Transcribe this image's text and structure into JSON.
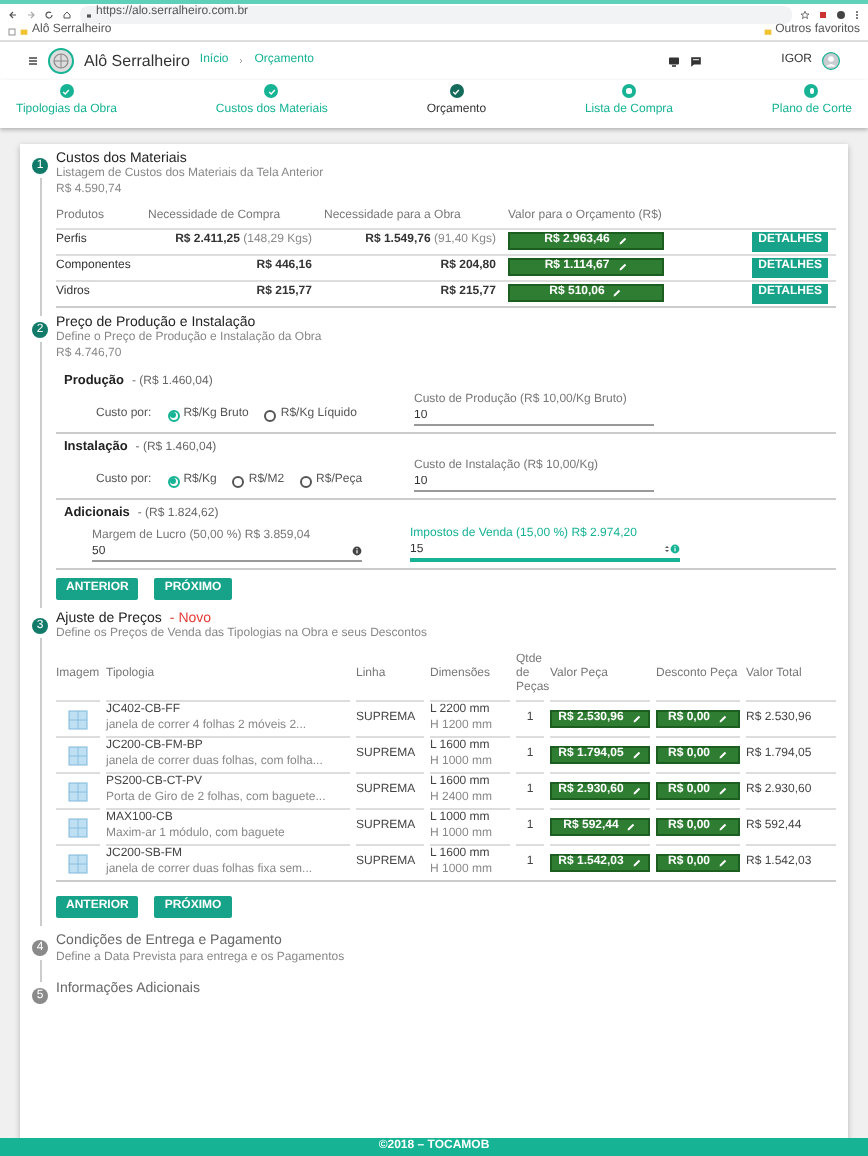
{
  "browser": {
    "url": "https://alo.serralheiro.com.br",
    "bookmark": "Alô Serralheiro",
    "other_bookmarks": "Outros favoritos"
  },
  "header": {
    "app_name": "Alô Serralheiro",
    "breadcrumb": [
      "Início",
      "Orçamento"
    ],
    "user": "IGOR"
  },
  "stepper": [
    {
      "label": "Tipologias da Obra",
      "done": true,
      "selected": false
    },
    {
      "label": "Custos dos Materiais",
      "done": true,
      "selected": false
    },
    {
      "label": "Orçamento",
      "done": true,
      "selected": true
    },
    {
      "label": "Lista de Compra",
      "done": false,
      "selected": false
    },
    {
      "label": "Plano de Corte",
      "done": false,
      "selected": false
    }
  ],
  "materials": {
    "number": "1",
    "active": true,
    "title": "Custos dos Materiais",
    "subtitle": "Listagem de Custos dos Materiais da Tela Anterior",
    "total": "R$ 4.590,74",
    "columns": [
      "Produtos",
      "Necessidade de Compra",
      "Necessidade para a Obra",
      "Valor para o Orçamento (R$)"
    ],
    "rows": [
      {
        "product": "Perfis",
        "purchase": "R$ 2.411,25",
        "purchase_weight": "(148,29 Kgs)",
        "work": "R$ 1.549,76",
        "work_weight": "(91,40 Kgs)",
        "value": "R$ 2.963,46",
        "action": "DETALHES"
      },
      {
        "product": "Componentes",
        "purchase": "R$ 446,16",
        "work": "R$ 204,80",
        "value": "R$ 1.114,67",
        "action": "DETALHES"
      },
      {
        "product": "Vidros",
        "purchase": "R$ 215,77",
        "work": "R$ 215,77",
        "value": "R$ 510,06",
        "action": "DETALHES"
      }
    ]
  },
  "production": {
    "number": "2",
    "active": true,
    "title": "Preço de Produção e Instalação",
    "subtitle": "Define o Preço de Produção e Instalação da Obra",
    "total": "R$ 4.746,70",
    "groups": [
      {
        "kind": "radio",
        "title": "Produção",
        "amount": "- (R$ 1.460,04)",
        "cost_label": "Custo por:",
        "options": [
          {
            "label": "R$/Kg Bruto",
            "selected": true
          },
          {
            "label": "R$/Kg Líquido",
            "selected": false
          }
        ],
        "field_label": "Custo de Produção (R$ 10,00/Kg Bruto)",
        "field_value": "10",
        "focused": false
      },
      {
        "kind": "radio",
        "title": "Instalação",
        "amount": "- (R$ 1.460,04)",
        "cost_label": "Custo por:",
        "options": [
          {
            "label": "R$/Kg",
            "selected": true
          },
          {
            "label": "R$/M2",
            "selected": false
          },
          {
            "label": "R$/Peça",
            "selected": false
          }
        ],
        "field_label": "Custo de Instalação (R$ 10,00/Kg)",
        "field_value": "10",
        "focused": false
      },
      {
        "kind": "pair",
        "title": "Adicionais",
        "amount": "- (R$ 1.824,62)",
        "fields": [
          {
            "label": "Margem de Lucro (50,00 %) R$ 3.859,04",
            "value": "50",
            "focused": false
          },
          {
            "label": "Impostos de Venda (15,00 %) R$ 2.974,20",
            "value": "15",
            "focused": true
          }
        ]
      }
    ],
    "buttons": [
      "ANTERIOR",
      "PRÓXIMO"
    ]
  },
  "pricing": {
    "number": "3",
    "active": true,
    "title": "Ajuste de Preços",
    "badge": "- Novo",
    "subtitle": "Define os Preços de Venda das Tipologias na Obra e seus Descontos",
    "columns": [
      "Imagem",
      "Tipologia",
      "Linha",
      "Dimensões",
      "Qtde de Peças",
      "Valor Peça",
      "Desconto Peça",
      "Valor Total"
    ],
    "rows": [
      {
        "code": "JC402-CB-FF",
        "description": "janela de correr 4 folhas 2 móveis 2...",
        "line": "SUPREMA",
        "width": "L 2200 mm",
        "height": "H 1200 mm",
        "qty": "1",
        "price": "R$ 2.530,96",
        "discount": "R$ 0,00",
        "total": "R$ 2.530,96"
      },
      {
        "code": "JC200-CB-FM-BP",
        "description": "janela de correr duas folhas, com folha...",
        "line": "SUPREMA",
        "width": "L 1600 mm",
        "height": "H 1000 mm",
        "qty": "1",
        "price": "R$ 1.794,05",
        "discount": "R$ 0,00",
        "total": "R$ 1.794,05"
      },
      {
        "code": "PS200-CB-CT-PV",
        "description": "Porta de Giro de 2 folhas, com baguete...",
        "line": "SUPREMA",
        "width": "L 1600 mm",
        "height": "H 2400 mm",
        "qty": "1",
        "price": "R$ 2.930,60",
        "discount": "R$ 0,00",
        "total": "R$ 2.930,60"
      },
      {
        "code": "MAX100-CB",
        "description": "Maxim-ar 1 módulo, com baguete",
        "line": "SUPREMA",
        "width": "L 1000 mm",
        "height": "H 1000 mm",
        "qty": "1",
        "price": "R$ 592,44",
        "discount": "R$ 0,00",
        "total": "R$ 592,44"
      },
      {
        "code": "JC200-SB-FM",
        "description": "janela de correr duas folhas fixa sem...",
        "line": "SUPREMA",
        "width": "L 1600 mm",
        "height": "H 1000 mm",
        "qty": "1",
        "price": "R$ 1.542,03",
        "discount": "R$ 0,00",
        "total": "R$ 1.542,03"
      }
    ],
    "buttons": [
      "ANTERIOR",
      "PRÓXIMO"
    ]
  },
  "delivery": {
    "number": "4",
    "active": false,
    "title": "Condições de Entrega e Pagamento",
    "subtitle": "Define a Data Prevista para entrega e os Pagamentos"
  },
  "extra": {
    "number": "5",
    "active": false,
    "title": "Informações Adicionais"
  },
  "footer": "©2018 – TOCAMOB"
}
